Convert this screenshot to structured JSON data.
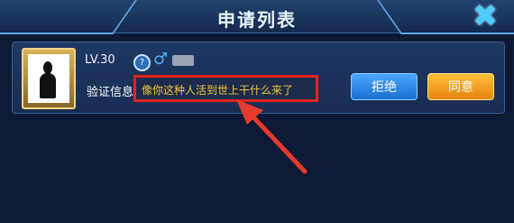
{
  "header": {
    "title": "申请列表",
    "close_icon": "close-icon"
  },
  "request": {
    "level": "LV.30",
    "verify_label": "验证信息",
    "message": "像你这种人活到世上干什么来了",
    "reject_label": "拒绝",
    "agree_label": "同意"
  },
  "colors": {
    "accent_blue": "#4ea6ff",
    "accent_orange": "#ffbf3b",
    "highlight_red": "#e0241b",
    "message_text": "#f2c23a"
  }
}
